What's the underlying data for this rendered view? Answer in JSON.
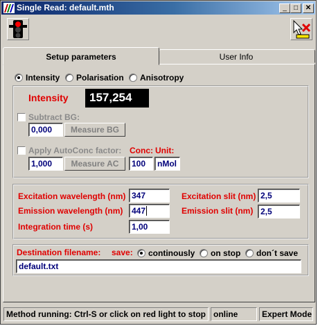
{
  "window": {
    "title": "Single Read: default.mth",
    "minimize": "_",
    "maximize": "□",
    "close": "✕"
  },
  "tabs": {
    "setup": "Setup parameters",
    "user_info": "User Info"
  },
  "mode": {
    "options": [
      "Intensity",
      "Polarisation",
      "Anisotropy"
    ],
    "selected": "Intensity"
  },
  "intensity": {
    "label": "Intensity",
    "value": "157,254"
  },
  "subtract_bg": {
    "label": "Subtract BG:",
    "value": "0,000",
    "button": "Measure BG"
  },
  "autoconc": {
    "label": "Apply AutoConc factor:",
    "value": "1,000",
    "button": "Measure AC",
    "conc_label": "Conc:",
    "conc_value": "100",
    "unit_label": "Unit:",
    "unit_value": "nMol"
  },
  "params": {
    "excitation_wavelength_label": "Excitation wavelength (nm)",
    "excitation_wavelength": "347",
    "emission_wavelength_label": "Emission wavelength (nm)",
    "emission_wavelength": "447",
    "integration_time_label": "Integration time (s)",
    "integration_time": "1,00",
    "excitation_slit_label": "Excitation slit (nm)",
    "excitation_slit": "2,5",
    "emission_slit_label": "Emission slit (nm)",
    "emission_slit": "2,5"
  },
  "destination": {
    "label": "Destination filename:",
    "save_label": "save:",
    "save_options": [
      "continously",
      "on stop",
      "don´t save"
    ],
    "save_selected": "continously",
    "filename": "default.txt"
  },
  "status": {
    "message": "Method running: Ctrl-S or click on red light to stop",
    "connection": "online",
    "mode": "Expert Mode"
  }
}
